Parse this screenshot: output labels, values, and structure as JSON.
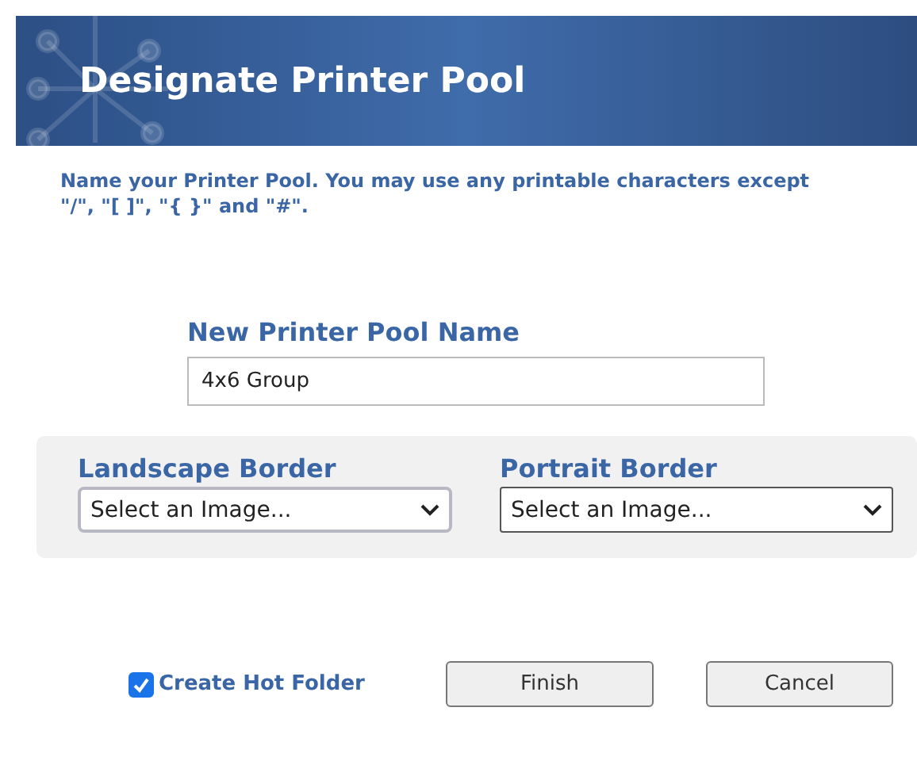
{
  "window": {
    "title": "Designate Printer Pool"
  },
  "instructions": "Name your Printer Pool. You may use any printable characters except \"/\", \"[ ]\", \"{ }\" and \"#\".",
  "name_field": {
    "label": "New Printer Pool Name",
    "value": "4x6 Group"
  },
  "borders": [
    {
      "label": "Landscape Border",
      "value": "Select an Image..."
    },
    {
      "label": "Portrait Border",
      "value": "Select an Image..."
    }
  ],
  "hot_folder": {
    "label": "Create Hot Folder",
    "checked": true
  },
  "buttons": [
    "Finish",
    "Cancel"
  ]
}
